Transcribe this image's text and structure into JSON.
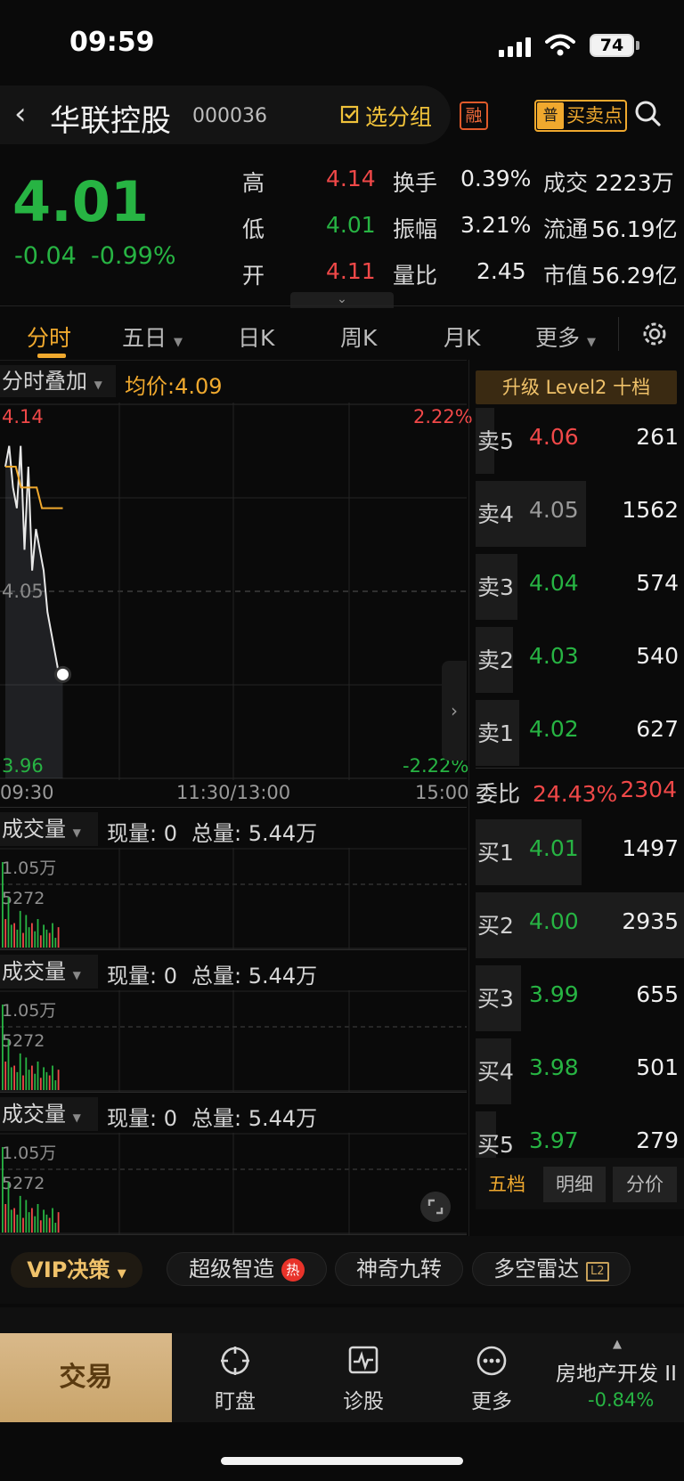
{
  "status_bar": {
    "time": "09:59",
    "battery": "74"
  },
  "header": {
    "stock_name": "华联控股",
    "stock_code": "000036",
    "add_group": "选分组",
    "rong": "融",
    "trade_point_icon": "普",
    "trade_point": "买卖点"
  },
  "quote": {
    "price": "4.01",
    "change": "-0.04",
    "change_pct": "-0.99%",
    "stats": {
      "high_label": "高",
      "high": "4.14",
      "low_label": "低",
      "low": "4.01",
      "open_label": "开",
      "open": "4.11",
      "turnover_label": "换手",
      "turnover": "0.39%",
      "amplitude_label": "振幅",
      "amplitude": "3.21%",
      "volume_ratio_label": "量比",
      "volume_ratio": "2.45",
      "amount_label": "成交",
      "amount": "2223万",
      "float_label": "流通",
      "float_value": "56.19亿",
      "cap_label": "市值",
      "cap": "56.29亿"
    }
  },
  "tabs": {
    "t1": "分时",
    "t2": "五日",
    "t3": "日K",
    "t4": "周K",
    "t5": "月K",
    "t6": "更多"
  },
  "chart": {
    "overlay": "分时叠加",
    "avg_label": "均价:4.09",
    "price_top": "4.14",
    "price_mid": "4.05",
    "price_bot": "3.96",
    "pct_top": "2.22%",
    "pct_bot": "-2.22%",
    "time_start": "09:30",
    "time_mid": "11:30/13:00",
    "time_end": "15:00"
  },
  "chart_data": {
    "type": "line",
    "ylim": [
      3.96,
      4.14
    ],
    "series": [
      {
        "values": [
          4.11,
          4.12,
          4.1,
          4.09,
          4.12,
          4.07,
          4.11,
          4.06,
          4.08,
          4.07,
          4.06,
          4.04,
          4.03,
          4.02,
          4.01,
          4.01
        ]
      },
      {
        "values": [
          4.11,
          4.11,
          4.11,
          4.1,
          4.1,
          4.1,
          4.1,
          4.09,
          4.09,
          4.09,
          4.09,
          4.09
        ]
      }
    ]
  },
  "volume_panels": [
    {
      "label": "成交量",
      "now": "现量: 0",
      "total": "总量: 5.44万",
      "max": "1.05万",
      "mid": "5272"
    },
    {
      "label": "成交量",
      "now": "现量: 0",
      "total": "总量: 5.44万",
      "max": "1.05万",
      "mid": "5272"
    },
    {
      "label": "成交量",
      "now": "现量: 0",
      "total": "总量: 5.44万",
      "max": "1.05万",
      "mid": "5272"
    }
  ],
  "volume_bars": [
    1.05,
    0.35,
    0.62,
    0.28,
    0.3,
    0.22,
    0.45,
    0.18,
    0.4,
    0.25,
    0.3,
    0.2,
    0.35,
    0.15,
    0.28,
    0.22,
    0.18,
    0.3,
    0.12,
    0.25
  ],
  "order_book": {
    "level2": "升级 Level2 十档",
    "asks": [
      {
        "side": "卖5",
        "price": "4.06",
        "vol": "261",
        "fill": 0.09
      },
      {
        "side": "卖4",
        "price": "4.05",
        "vol": "1562",
        "fill": 0.53
      },
      {
        "side": "卖3",
        "price": "4.04",
        "vol": "574",
        "fill": 0.2
      },
      {
        "side": "卖2",
        "price": "4.03",
        "vol": "540",
        "fill": 0.18
      },
      {
        "side": "卖1",
        "price": "4.02",
        "vol": "627",
        "fill": 0.21
      }
    ],
    "ratio_label": "委比",
    "ratio_pct": "24.43%",
    "ratio_vol": "2304",
    "bids": [
      {
        "side": "买1",
        "price": "4.01",
        "vol": "1497",
        "fill": 0.51
      },
      {
        "side": "买2",
        "price": "4.00",
        "vol": "2935",
        "fill": 1.0
      },
      {
        "side": "买3",
        "price": "3.99",
        "vol": "655",
        "fill": 0.22
      },
      {
        "side": "买4",
        "price": "3.98",
        "vol": "501",
        "fill": 0.17
      },
      {
        "side": "买5",
        "price": "3.97",
        "vol": "279",
        "fill": 0.1
      }
    ],
    "tabs": [
      "五档",
      "明细",
      "分价"
    ]
  },
  "features": {
    "vip": "VIP决策",
    "f1": "超级智造",
    "f1_badge": "热",
    "f2": "神奇九转",
    "f3": "多空雷达"
  },
  "bottom_nav": {
    "trade": "交易",
    "watch": "盯盘",
    "diagnose": "诊股",
    "more": "更多",
    "sector": "房地产开发 II",
    "sector_chg": "-0.84%"
  }
}
